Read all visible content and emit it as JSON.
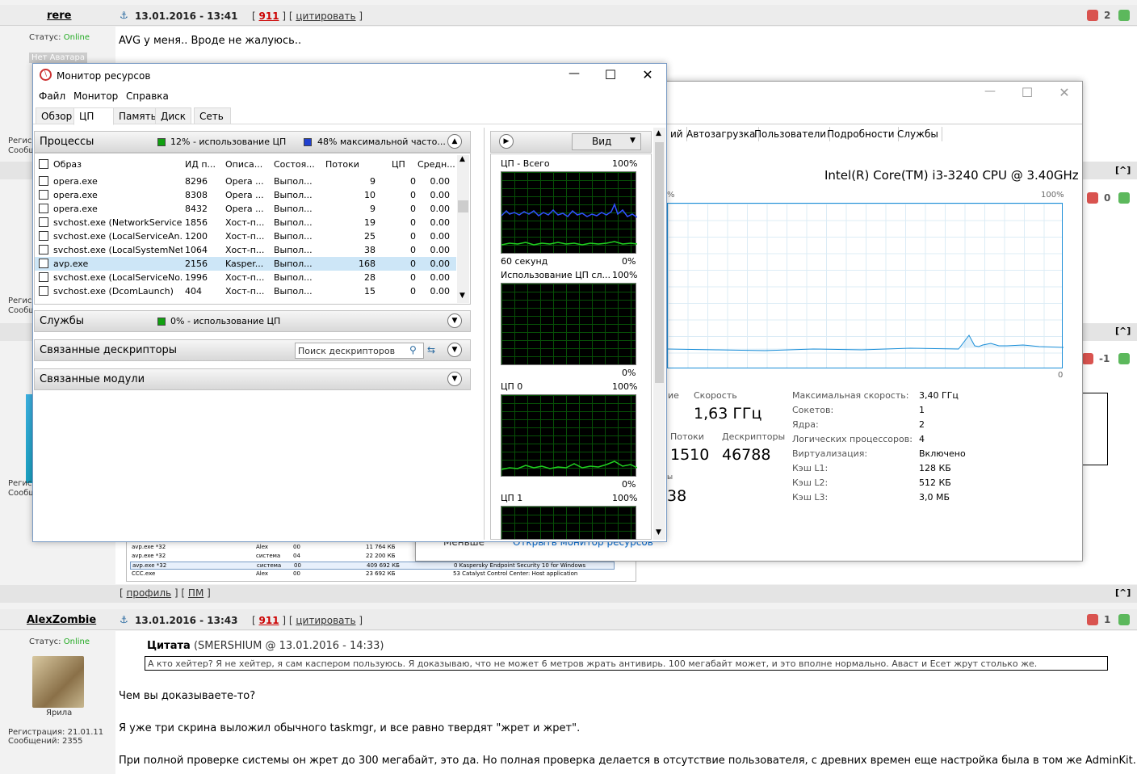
{
  "forum": {
    "post1": {
      "user": "rere",
      "date": "13.01.2016 - 13:41",
      "num": "911",
      "quote_link": "цитировать",
      "status_label": "Статус:",
      "status": "Online",
      "no_avatar": "Нет Аватара",
      "text": "AVG у меня.. Вроде не жалуюсь..",
      "rating": "2"
    },
    "reg_label": "Регис",
    "msgs_label": "Сообщ",
    "rating_b": "0",
    "rating_c": "-1",
    "rating_d": "1",
    "up_glyph": "[^]",
    "profile": "профиль",
    "pm": "ПМ",
    "post2": {
      "user": "AlexZombie",
      "date": "13.01.2016 - 13:43",
      "num": "911",
      "quote_link": "цитировать",
      "status_label": "Статус:",
      "status": "Online",
      "avatar_caption": "Ярила",
      "reg": "Регистрация: 21.01.11",
      "msgs": "Сообщений: 2355",
      "quote_title": "Цитата",
      "quote_src": "(SMERSHIUM @ 13.01.2016 - 14:33)",
      "quote_text": "А кто хейтер? Я не хейтер, я сам каспером пользуюсь. Я доказываю, что не может 6 метров жрать антивирь. 100 мегабайт может, и это вполне нормально. Аваст и Есет жрут столько же.",
      "p1": "Чем вы доказываете-то?",
      "p2": "Я уже три скрина выложил обычного taskmgr, и все равно твердят \"жрет и жрет\".",
      "p3": "При полной проверке системы он жрет до 300 мегабайт, это да. Но полная проверка делается в отсутствие пользователя, с древних времен еще настройка была в том же AdminKit."
    },
    "screenshot_rows": [
      {
        "name": "avp.exe *32",
        "user": "Alex",
        "cpu": "00",
        "mem": "11 764 КБ",
        "desc": ""
      },
      {
        "name": "avp.exe *32",
        "user": "система",
        "cpu": "04",
        "mem": "22 200 КБ",
        "desc": ""
      },
      {
        "name": "avp.exe *32",
        "user": "система",
        "cpu": "00",
        "mem": "409 692 КБ",
        "desc": "0   Kaspersky Endpoint Security 10 for Windows"
      },
      {
        "name": "CCC.exe",
        "user": "Alex",
        "cpu": "00",
        "mem": "23 692 КБ",
        "desc": "53   Catalyst Control Center: Host application"
      }
    ],
    "hidden_link": "Открыть монитор ресурсов",
    "less": "Меньше"
  },
  "taskmgr": {
    "tabs": [
      "ий",
      "Автозагрузка",
      "Пользователи",
      "Подробности",
      "Службы"
    ],
    "cpu_name": "Intel(R) Core(TM) i3-3240 CPU @ 3.40GHz",
    "pct100": "100%",
    "pct0": "0",
    "pct_left": "%",
    "speed_label": "Скорость",
    "speed": "1,63 ГГц",
    "util_label": "ие",
    "threads_label": "Потоки",
    "threads": "1510",
    "handles_label": "Дескрипторы",
    "handles": "46788",
    "uptime_part": "38",
    "uptime_label": "ы",
    "props": [
      {
        "k": "Максимальная скорость:",
        "v": "3,40 ГГц"
      },
      {
        "k": "Сокетов:",
        "v": "1"
      },
      {
        "k": "Ядра:",
        "v": "2"
      },
      {
        "k": "Логических процессоров:",
        "v": "4"
      },
      {
        "k": "Виртуализация:",
        "v": "Включено"
      },
      {
        "k": "Кэш L1:",
        "v": "128 КБ"
      },
      {
        "k": "Кэш L2:",
        "v": "512 КБ"
      },
      {
        "k": "Кэш L3:",
        "v": "3,0 МБ"
      }
    ]
  },
  "resmon": {
    "title": "Монитор ресурсов",
    "menu": [
      "Файл",
      "Монитор",
      "Справка"
    ],
    "tabs": [
      "Обзор",
      "ЦП",
      "Память",
      "Диск",
      "Сеть"
    ],
    "proc_title": "Процессы",
    "proc_cpu": "12% - использование ЦП",
    "proc_freq": "48% максимальной часто...",
    "cols": [
      "Образ",
      "ИД п...",
      "Описа...",
      "Состоя...",
      "Потоки",
      "ЦП",
      "Средн..."
    ],
    "rows": [
      {
        "name": "opera.exe",
        "pid": "8296",
        "desc": "Opera ...",
        "state": "Выпол...",
        "thr": "9",
        "cpu": "0",
        "avg": "0.00"
      },
      {
        "name": "opera.exe",
        "pid": "8308",
        "desc": "Opera ...",
        "state": "Выпол...",
        "thr": "10",
        "cpu": "0",
        "avg": "0.00"
      },
      {
        "name": "opera.exe",
        "pid": "8432",
        "desc": "Opera ...",
        "state": "Выпол...",
        "thr": "9",
        "cpu": "0",
        "avg": "0.00"
      },
      {
        "name": "svchost.exe (NetworkService)",
        "pid": "1856",
        "desc": "Хост-п...",
        "state": "Выпол...",
        "thr": "19",
        "cpu": "0",
        "avg": "0.00"
      },
      {
        "name": "svchost.exe (LocalServiceAn...",
        "pid": "1200",
        "desc": "Хост-п...",
        "state": "Выпол...",
        "thr": "25",
        "cpu": "0",
        "avg": "0.00"
      },
      {
        "name": "svchost.exe (LocalSystemNet...",
        "pid": "1064",
        "desc": "Хост-п...",
        "state": "Выпол...",
        "thr": "38",
        "cpu": "0",
        "avg": "0.00"
      },
      {
        "name": "avp.exe",
        "pid": "2156",
        "desc": "Kasper...",
        "state": "Выпол...",
        "thr": "168",
        "cpu": "0",
        "avg": "0.00"
      },
      {
        "name": "svchost.exe (LocalServiceNo...",
        "pid": "1996",
        "desc": "Хост-п...",
        "state": "Выпол...",
        "thr": "28",
        "cpu": "0",
        "avg": "0.00"
      },
      {
        "name": "svchost.exe (DcomLaunch)",
        "pid": "404",
        "desc": "Хост-п...",
        "state": "Выпол...",
        "thr": "15",
        "cpu": "0",
        "avg": "0.00"
      }
    ],
    "services_title": "Службы",
    "services_cpu": "0% - использование ЦП",
    "handles_title": "Связанные дескрипторы",
    "handles_search": "Поиск дескрипторов",
    "modules_title": "Связанные модули",
    "view": "Вид",
    "g_total": "ЦП - Всего",
    "g_svc": "Использование ЦП сл...",
    "g_cpu0": "ЦП 0",
    "g_cpu1": "ЦП 1",
    "g100": "100%",
    "g0": "0%",
    "g60": "60 секунд",
    "colors": {
      "cpu_green": "#10a010",
      "freq_blue": "#2040d0"
    }
  }
}
